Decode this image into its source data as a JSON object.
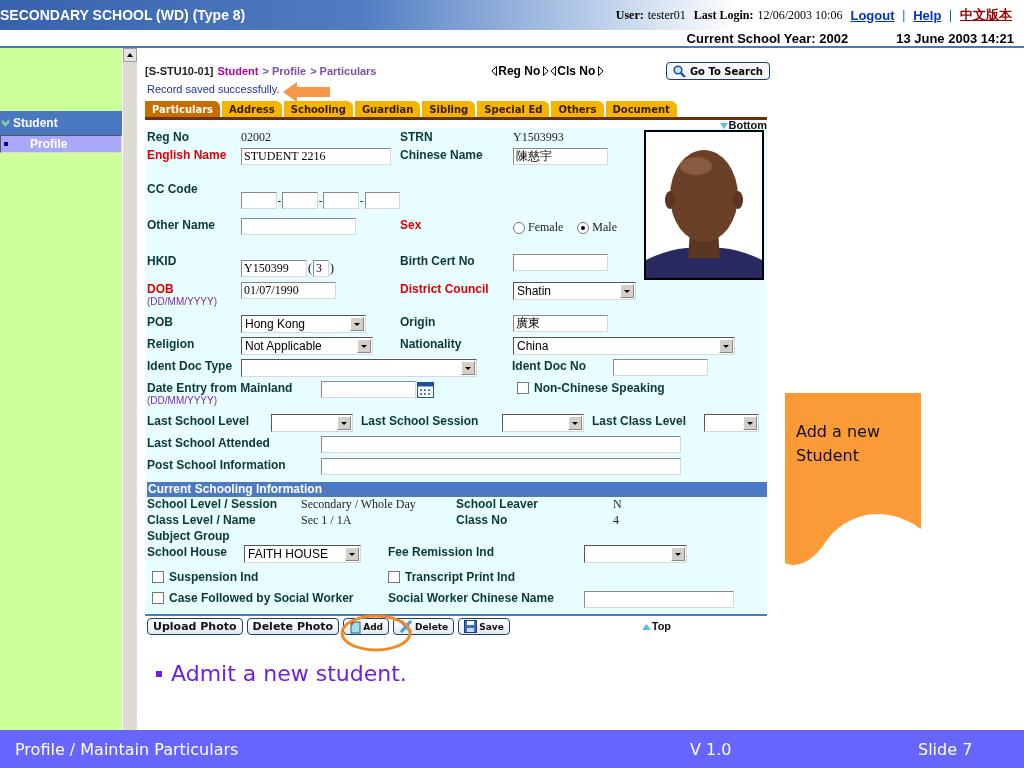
{
  "header": {
    "title": "SECONDARY SCHOOL (WD) (Type 8)",
    "user_label": "User:",
    "user": "tester01",
    "login_label": "Last Login:",
    "login": "12/06/2003 10:06",
    "links": [
      {
        "kind": "link",
        "text": "Logout"
      },
      {
        "kind": "separator",
        "text": "|"
      },
      {
        "kind": "link",
        "text": "Help"
      },
      {
        "kind": "separator",
        "text": "|"
      },
      {
        "kind": "alt_link",
        "text": "中文版本"
      }
    ],
    "school_year": "Current School Year: 2002",
    "datetime": "13 June 2003 14:21"
  },
  "sidebar": {
    "items": [
      {
        "label": "Student",
        "expanded": true,
        "selected": false,
        "children": [
          {
            "label": "Profile",
            "selected": true
          }
        ]
      }
    ]
  },
  "page": {
    "code": "[S-STU10-01]",
    "breadcrumb": [
      "Student",
      "> Profile",
      "> Particulars"
    ],
    "record_nav": [
      "Reg No",
      "Cls No"
    ],
    "search_button": "Go To Search",
    "message": "Record saved successfully.",
    "bottom_link": "Bottom",
    "top_link": "Top"
  },
  "tabs": [
    {
      "label": "Particulars",
      "selected": true
    },
    {
      "label": "Address",
      "selected": false
    },
    {
      "label": "Schooling",
      "selected": false
    },
    {
      "label": "Guardian",
      "selected": false
    },
    {
      "label": "Sibling",
      "selected": false
    },
    {
      "label": "Special Ed",
      "selected": false
    },
    {
      "label": "Others",
      "selected": false
    },
    {
      "label": "Document",
      "selected": false
    }
  ],
  "form": {
    "reg_no": {
      "label": "Reg No",
      "required": false,
      "value": "02002"
    },
    "strn": {
      "label": "STRN",
      "required": false,
      "value": "Y1503993"
    },
    "english_name": {
      "label": "English Name",
      "required": true,
      "value": "STUDENT 2216"
    },
    "chinese_name": {
      "label": "Chinese Name",
      "required": false,
      "value": "陳慈宇"
    },
    "cc_code": {
      "label": "CC Code",
      "required": false,
      "separators": [
        "-",
        "-",
        "-"
      ]
    },
    "other_name": {
      "label": "Other Name",
      "required": false
    },
    "sex": {
      "label": "Sex",
      "required": true,
      "options": [
        {
          "label": "Female",
          "selected": false
        },
        {
          "label": "Male",
          "selected": true
        }
      ]
    },
    "hkid": {
      "label": "HKID",
      "required": false,
      "value": "Y150399",
      "open": "(",
      "check_digit": "3",
      "close": ")"
    },
    "birth_cert_no": {
      "label": "Birth Cert No",
      "required": false
    },
    "dob": {
      "label": "DOB",
      "hint": "(DD/MM/YYYY)",
      "required": true,
      "value": "01/07/1990"
    },
    "district_council": {
      "label": "District Council",
      "required": true,
      "value": "Shatin"
    },
    "pob": {
      "label": "POB",
      "required": false,
      "value": "Hong Kong"
    },
    "origin": {
      "label": "Origin",
      "required": false,
      "value": "廣東"
    },
    "religion": {
      "label": "Religion",
      "required": false,
      "value": "Not Applicable"
    },
    "nationality": {
      "label": "Nationality",
      "required": false,
      "value": "China"
    },
    "ident_doc_type": {
      "label": "Ident Doc Type",
      "required": false
    },
    "ident_doc_no": {
      "label": "Ident Doc No",
      "required": false
    },
    "date_entry": {
      "label": "Date Entry from Mainland",
      "hint": "(DD/MM/YYYY)",
      "required": false
    },
    "non_chinese": {
      "label": "Non-Chinese Speaking",
      "checked": false
    },
    "last_school_level": {
      "label": "Last School Level",
      "required": false
    },
    "last_school_session": {
      "label": "Last School Session",
      "required": false
    },
    "last_class_level": {
      "label": "Last Class Level",
      "required": false
    },
    "last_school_attended": {
      "label": "Last School Attended",
      "required": false
    },
    "post_school_info": {
      "label": "Post School Information",
      "required": false
    }
  },
  "schooling": {
    "title": "Current Schooling Information",
    "school_level_session": {
      "label": "School Level / Session",
      "value": "Secondary / Whole Day"
    },
    "school_leaver": {
      "label": "School Leaver",
      "value": "N"
    },
    "class_level_name": {
      "label": "Class Level / Name",
      "value": "Sec 1 / 1A"
    },
    "class_no": {
      "label": "Class No",
      "value": "4"
    },
    "subject_group": {
      "label": "Subject Group"
    },
    "school_house": {
      "label": "School House",
      "value": "FAITH HOUSE"
    },
    "fee_remission": {
      "label": "Fee Remission Ind"
    },
    "suspension": {
      "label": "Suspension Ind",
      "checked": false
    },
    "transcript": {
      "label": "Transcript Print Ind",
      "checked": false
    },
    "case_followed": {
      "label": "Case Followed by Social Worker",
      "checked": false
    },
    "social_worker_name": {
      "label": "Social Worker Chinese Name"
    }
  },
  "buttons": [
    {
      "kind": "text",
      "label": "Upload Photo"
    },
    {
      "kind": "text",
      "label": "Delete Photo"
    },
    {
      "kind": "add",
      "label": "Add"
    },
    {
      "kind": "delete",
      "label": "Delete"
    },
    {
      "kind": "save",
      "label": "Save"
    }
  ],
  "slide": {
    "bullet": "Admit a new student.",
    "callout": "Add a new Student",
    "footer_title": "Profile / Maintain Particulars",
    "version": "V 1.0",
    "slide_number": "Slide 7"
  }
}
